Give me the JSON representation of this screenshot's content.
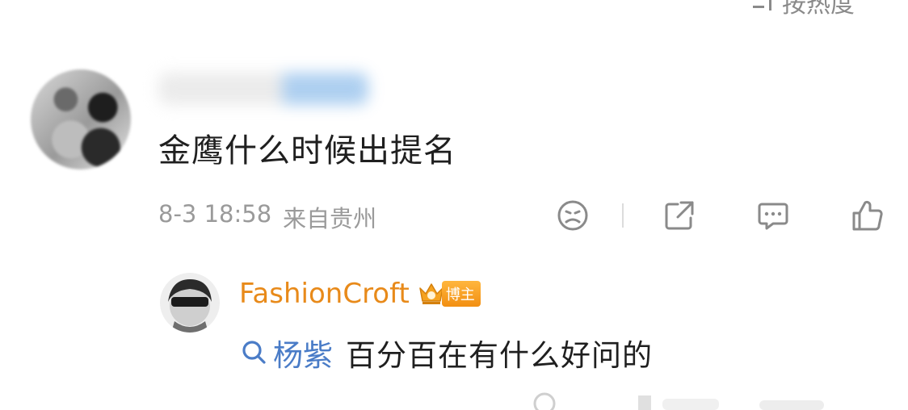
{
  "sort": {
    "label": "按热度"
  },
  "comment": {
    "text": "金鹰什么时候出提名",
    "date": "8-3 18:58",
    "location": "来自贵州"
  },
  "actions": {
    "icons": [
      "dislike-face-icon",
      "share-icon",
      "comment-icon",
      "like-icon"
    ]
  },
  "reply": {
    "author": "FashionCroft",
    "badge": "博主",
    "topic": "杨紫",
    "text": "百分百在有什么好问的"
  },
  "colors": {
    "reply_author": "#e88a1a",
    "topic_link": "#4a7cc7",
    "meta_gray": "#9a9a9a"
  }
}
